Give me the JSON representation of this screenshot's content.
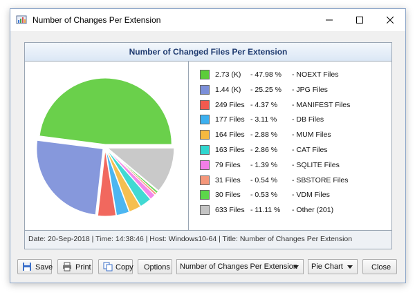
{
  "window": {
    "title": "Number of Changes Per Extension"
  },
  "panel": {
    "header": "Number of Changed Files Per Extension",
    "status": "Date: 20-Sep-2018 | Time: 14:38:46 | Host: Windows10-64 | Title: Number of Changes Per Extension"
  },
  "chart_data": {
    "type": "pie",
    "title": "Number of Changed Files Per Extension",
    "slices": [
      {
        "label": "NOEXT Files",
        "value_text": "2.73 (K)",
        "percent_text": "47.98 %",
        "percent": 47.98,
        "color": "#5ccc3a"
      },
      {
        "label": "JPG Files",
        "value_text": "1.44 (K)",
        "percent_text": "25.25 %",
        "percent": 25.25,
        "color": "#7b8fd9"
      },
      {
        "label": "MANIFEST Files",
        "value_text": "249 Files",
        "percent_text": "4.37 %",
        "percent": 4.37,
        "color": "#f05a4f"
      },
      {
        "label": "DB Files",
        "value_text": "177 Files",
        "percent_text": "3.11 %",
        "percent": 3.11,
        "color": "#3cb0f0"
      },
      {
        "label": "MUM Files",
        "value_text": "164 Files",
        "percent_text": "2.88 %",
        "percent": 2.88,
        "color": "#f5b940"
      },
      {
        "label": "CAT Files",
        "value_text": "163 Files",
        "percent_text": "2.86 %",
        "percent": 2.86,
        "color": "#30d6cf"
      },
      {
        "label": "SQLITE Files",
        "value_text": "79 Files",
        "percent_text": "1.39 %",
        "percent": 1.39,
        "color": "#f27ee8"
      },
      {
        "label": "SBSTORE Files",
        "value_text": "31 Files",
        "percent_text": "0.54 %",
        "percent": 0.54,
        "color": "#f5977a"
      },
      {
        "label": "VDM Files",
        "value_text": "30 Files",
        "percent_text": "0.53 %",
        "percent": 0.53,
        "color": "#5cd64a"
      },
      {
        "label": "Other (201)",
        "value_text": "633 Files",
        "percent_text": "11.11 %",
        "percent": 11.11,
        "color": "#c4c4c4"
      }
    ]
  },
  "toolbar": {
    "save": "Save",
    "print": "Print",
    "copy": "Copy",
    "options": "Options",
    "report_select": "Number of Changes Per Extension",
    "chart_type_select": "Pie Chart",
    "close": "Close"
  },
  "icons": {
    "app": "chart-window-icon",
    "save": "floppy-disk-icon",
    "print": "printer-icon",
    "copy": "copy-icon"
  }
}
